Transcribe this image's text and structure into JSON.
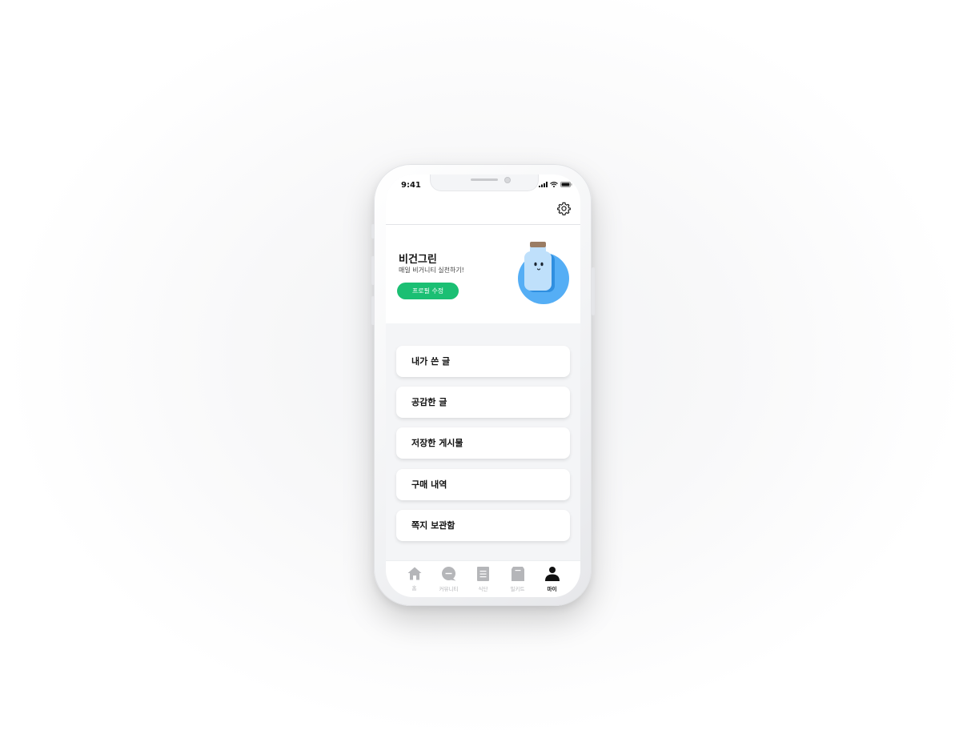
{
  "status_bar": {
    "time": "9:41"
  },
  "header": {
    "settings_icon": "gear-icon"
  },
  "profile": {
    "name": "비건그린",
    "description": "매일 비거니티 실천하기!",
    "edit_button": "프로필 수정",
    "avatar_icon": "jar-mascot-icon"
  },
  "menu": [
    {
      "label": "내가 쓴 글"
    },
    {
      "label": "공감한 글"
    },
    {
      "label": "저장한 게시물"
    },
    {
      "label": "구매 내역"
    },
    {
      "label": "쪽지 보관함"
    }
  ],
  "tabs": [
    {
      "label": "홈",
      "icon": "home-icon",
      "active": false
    },
    {
      "label": "커뮤니티",
      "icon": "chat-icon",
      "active": false
    },
    {
      "label": "식단",
      "icon": "document-icon",
      "active": false
    },
    {
      "label": "밀키트",
      "icon": "box-icon",
      "active": false
    },
    {
      "label": "마이",
      "icon": "person-icon",
      "active": true
    }
  ],
  "colors": {
    "accent": "#1bbf73",
    "avatar_circle": "#55aef5"
  }
}
